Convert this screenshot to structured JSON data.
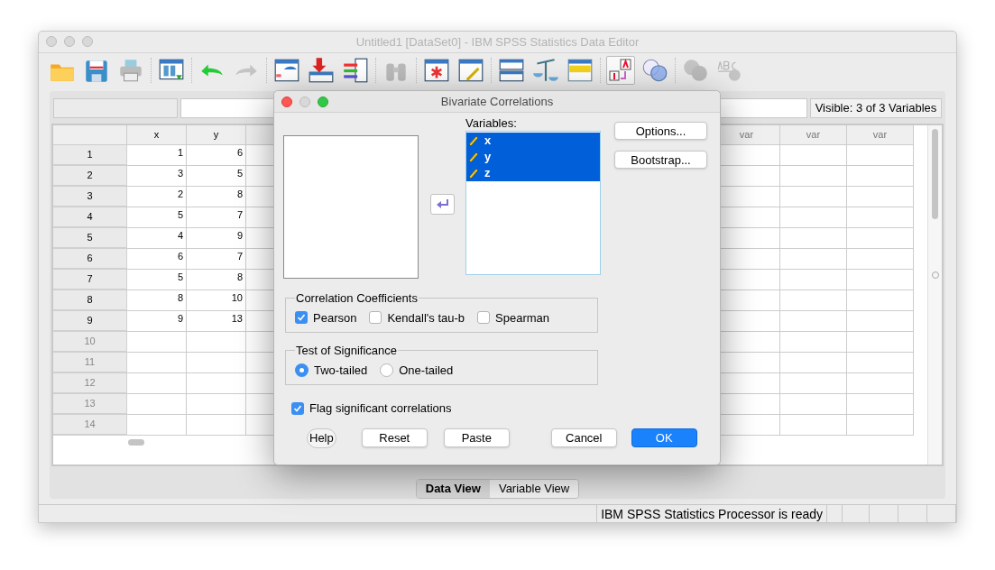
{
  "window": {
    "title": "Untitled1 [DataSet0] - IBM SPSS Statistics Data Editor"
  },
  "toolbar": [
    {
      "disabled": false,
      "on": false
    },
    {
      "disabled": false,
      "on": false
    },
    {
      "disabled": false,
      "on": false
    },
    {
      "disabled": false,
      "on": false
    },
    {
      "disabled": false,
      "on": false
    },
    {
      "disabled": true,
      "on": false
    },
    {
      "disabled": false,
      "on": false
    },
    {
      "disabled": false,
      "on": false
    },
    {
      "disabled": false,
      "on": false
    },
    {
      "disabled": true,
      "on": false
    },
    {
      "disabled": false,
      "on": false
    },
    {
      "disabled": false,
      "on": false
    },
    {
      "disabled": false,
      "on": false
    },
    {
      "disabled": false,
      "on": false
    },
    {
      "disabled": false,
      "on": false
    },
    {
      "disabled": false,
      "on": true
    },
    {
      "disabled": false,
      "on": false
    },
    {
      "disabled": true,
      "on": false
    },
    {
      "disabled": true,
      "on": false
    }
  ],
  "visible_variables": "Visible: 3 of 3 Variables",
  "grid": {
    "columns_left": [
      "x",
      "y"
    ],
    "columns_right": [
      "var",
      "var",
      "var"
    ],
    "rows": [
      {
        "label": "1",
        "cells": [
          "1",
          "6"
        ]
      },
      {
        "label": "2",
        "cells": [
          "3",
          "5"
        ]
      },
      {
        "label": "3",
        "cells": [
          "2",
          "8"
        ]
      },
      {
        "label": "4",
        "cells": [
          "5",
          "7"
        ]
      },
      {
        "label": "5",
        "cells": [
          "4",
          "9"
        ]
      },
      {
        "label": "6",
        "cells": [
          "6",
          "7"
        ]
      },
      {
        "label": "7",
        "cells": [
          "5",
          "8"
        ]
      },
      {
        "label": "8",
        "cells": [
          "8",
          "10"
        ]
      },
      {
        "label": "9",
        "cells": [
          "9",
          "13"
        ]
      },
      {
        "label": "10",
        "cells": []
      },
      {
        "label": "11",
        "cells": []
      },
      {
        "label": "12",
        "cells": []
      },
      {
        "label": "13",
        "cells": []
      },
      {
        "label": "14",
        "cells": []
      }
    ]
  },
  "view_tabs": [
    {
      "label": "Data View",
      "selected": true
    },
    {
      "label": "Variable View",
      "selected": false
    }
  ],
  "status_bar": {
    "text": "IBM SPSS Statistics Processor is ready"
  },
  "dialog": {
    "title": "Bivariate Correlations",
    "variables_label": "Variables:",
    "variables": [
      {
        "name": "x",
        "selected": true
      },
      {
        "name": "y",
        "selected": true
      },
      {
        "name": "z",
        "selected": true
      }
    ],
    "side_buttons": [
      "Options...",
      "Bootstrap..."
    ],
    "coefficients": {
      "title": "Correlation Coefficients",
      "options": [
        {
          "label": "Pearson",
          "checked": true
        },
        {
          "label": "Kendall's tau-b",
          "checked": false
        },
        {
          "label": "Spearman",
          "checked": false
        }
      ]
    },
    "significance": {
      "title": "Test of Significance",
      "options": [
        {
          "label": "Two-tailed",
          "selected": true
        },
        {
          "label": "One-tailed",
          "selected": false
        }
      ]
    },
    "flag": {
      "label": "Flag significant correlations",
      "checked": true
    },
    "buttons": [
      {
        "label": "Help",
        "kind": "help"
      },
      {
        "label": "Reset",
        "kind": "normal"
      },
      {
        "label": "Paste",
        "kind": "normal"
      },
      {
        "label": "Cancel",
        "kind": "normal"
      },
      {
        "label": "OK",
        "kind": "default"
      }
    ]
  }
}
